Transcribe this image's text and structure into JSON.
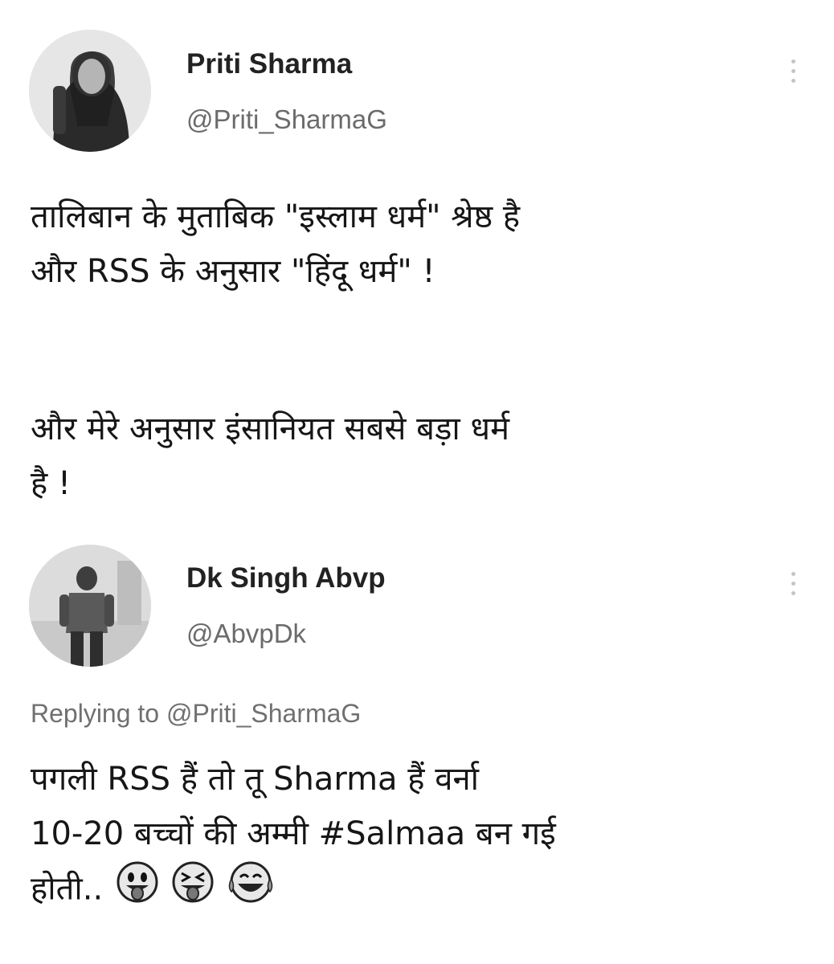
{
  "tweet_main": {
    "author_name": "Priti Sharma",
    "author_handle": "@Priti_SharmaG",
    "text_line_1": "तालिबान के मुताबिक \"इस्लाम धर्म\" श्रेष्ठ है",
    "text_line_2": "और RSS के अनुसार \"हिंदू धर्म\" !",
    "text_line_3": "और मेरे अनुसार इंसानियत सबसे बड़ा धर्म",
    "text_line_4": "है !"
  },
  "tweet_reply": {
    "author_name": "Dk Singh Abvp",
    "author_handle": "@AbvpDk",
    "replying_to": "Replying to @Priti_SharmaG",
    "text_line_1": "पगली RSS हैं तो तू Sharma हैं वर्ना",
    "text_line_2": "10-20 बच्चों की अम्मी #Salmaa बन गई",
    "text_line_3": "होती..",
    "emojis": [
      "tongue-out-face-icon",
      "squinting-tongue-face-icon",
      "tears-of-joy-face-icon"
    ]
  },
  "colors": {
    "text": "#161616",
    "handle": "#6b6b6b",
    "background": "#ffffff"
  }
}
